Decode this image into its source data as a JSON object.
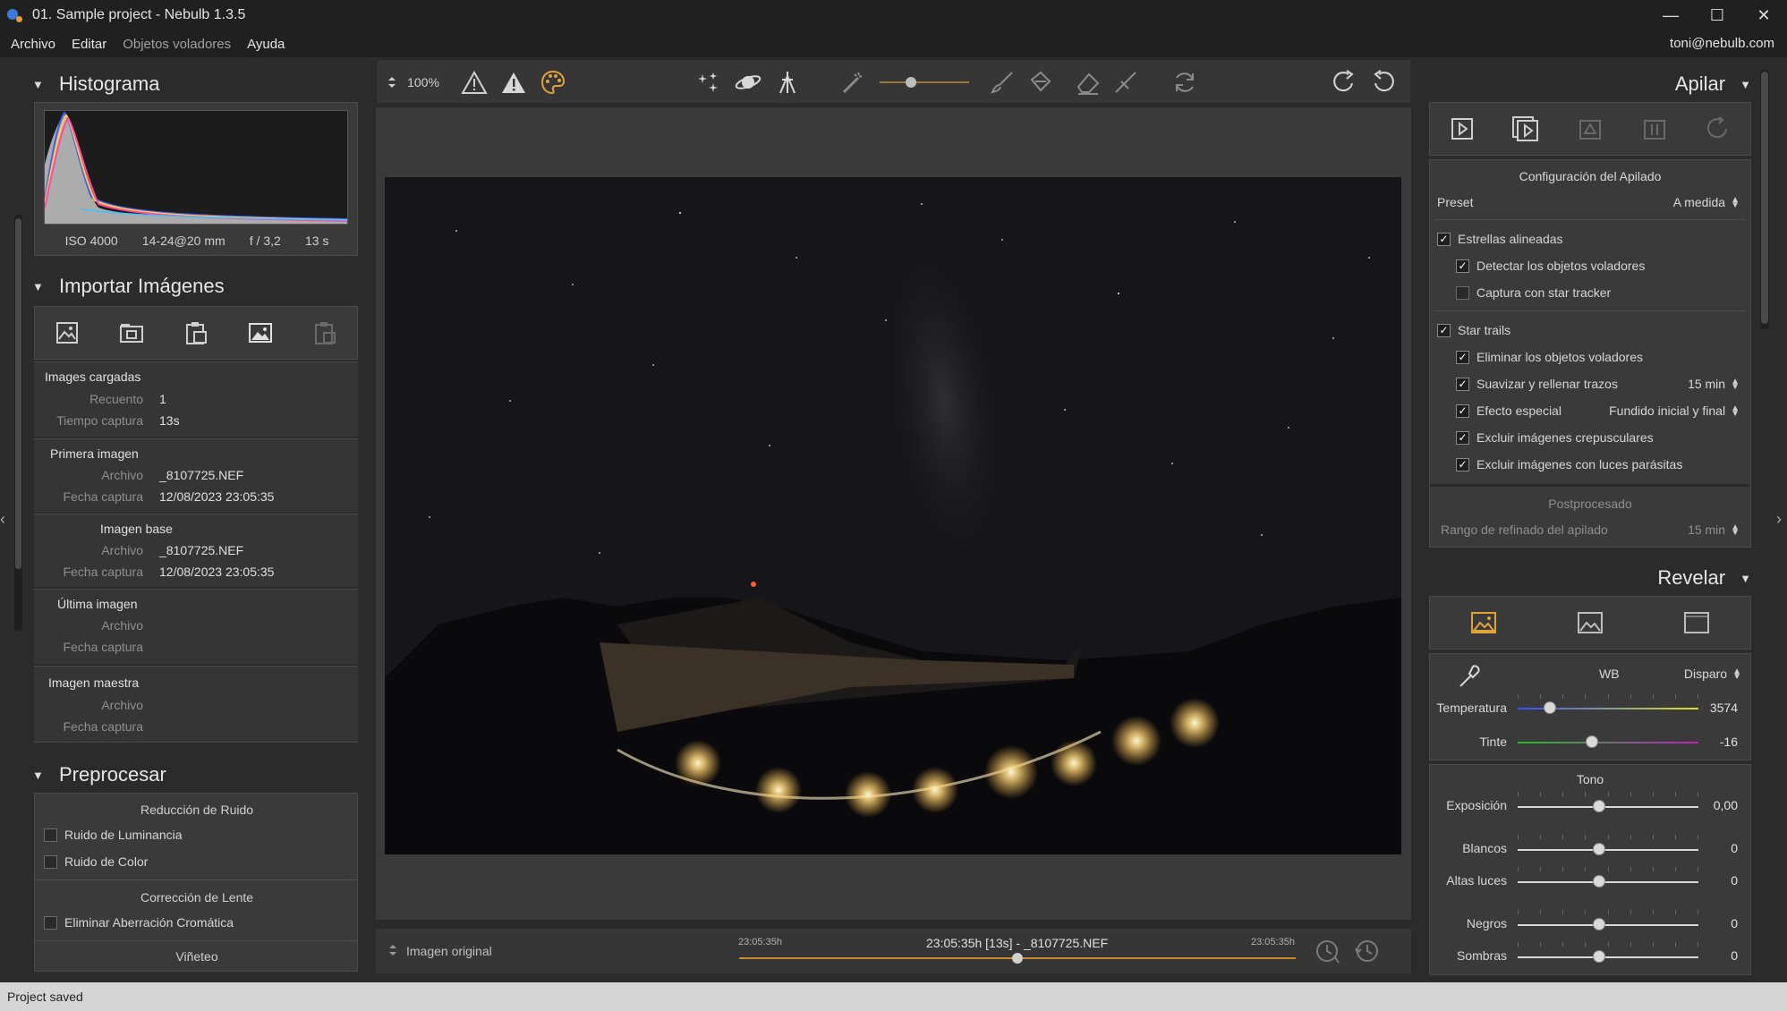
{
  "window": {
    "title": "01. Sample project - Nebulb 1.3.5",
    "minimize": "—",
    "maximize": "☐",
    "close": "✕"
  },
  "menu": {
    "items": [
      "Archivo",
      "Editar",
      "Objetos voladores",
      "Ayuda"
    ],
    "user": "toni@nebulb.com"
  },
  "histogram": {
    "title": "Histograma",
    "iso": "ISO 4000",
    "lens": "14-24@20 mm",
    "aperture": "f / 3,2",
    "exposure": "13 s"
  },
  "import": {
    "title": "Importar Imágenes",
    "loaded": {
      "title": "Images cargadas",
      "count_label": "Recuento",
      "count_value": "1",
      "time_label": "Tiempo captura",
      "time_value": "13s"
    },
    "first": {
      "title": "Primera imagen",
      "file_label": "Archivo",
      "file_value": "_8107725.NEF",
      "date_label": "Fecha captura",
      "date_value": "12/08/2023 23:05:35"
    },
    "base": {
      "title": "Imagen base",
      "file_label": "Archivo",
      "file_value": "_8107725.NEF",
      "date_label": "Fecha captura",
      "date_value": "12/08/2023 23:05:35"
    },
    "last": {
      "title": "Última imagen",
      "file_label": "Archivo",
      "date_label": "Fecha captura"
    },
    "master": {
      "title": "Imagen maestra",
      "file_label": "Archivo",
      "date_label": "Fecha captura"
    }
  },
  "preprocess": {
    "title": "Preprocesar",
    "noise_title": "Reducción de Ruido",
    "luminance": "Ruido de Luminancia",
    "color": "Ruido de Color",
    "lens_title": "Corrección de Lente",
    "chromatic": "Eliminar Aberración Cromática",
    "vignette": "Viñeteo"
  },
  "toolbar": {
    "zoom": "100%",
    "slider_fraction": 0.35
  },
  "timeline": {
    "mode": "Imagen original",
    "start": "23:05:35h",
    "center": "23:05:35h [13s] - _8107725.NEF",
    "end": "23:05:35h",
    "position_fraction": 0.5
  },
  "stack": {
    "title": "Apilar",
    "config_title": "Configuración del Apilado",
    "preset_label": "Preset",
    "preset_value": "A medida",
    "aligned": "Estrellas alineadas",
    "detect_flying": "Detectar los objetos voladores",
    "star_tracker": "Captura con star tracker",
    "star_trails": "Star trails",
    "remove_flying": "Eliminar los objetos voladores",
    "smooth": "Suavizar y rellenar trazos",
    "smooth_value": "15 min",
    "effect": "Efecto especial",
    "effect_value": "Fundido inicial y final",
    "exclude_twilight": "Excluir imágenes crepusculares",
    "exclude_lights": "Excluir imágenes con luces parásitas",
    "post_title": "Postprocesado",
    "refine_label": "Rango de refinado del apilado",
    "refine_value": "15 min"
  },
  "develop": {
    "title": "Revelar",
    "wb_label": "WB",
    "wb_value": "Disparo",
    "temp_label": "Temperatura",
    "temp_value": "3574",
    "temp_fraction": 0.18,
    "tint_label": "Tinte",
    "tint_value": "-16",
    "tint_fraction": 0.41,
    "tone_title": "Tono",
    "exposure_label": "Exposición",
    "exposure_value": "0,00",
    "whites_label": "Blancos",
    "whites_value": "0",
    "highlights_label": "Altas luces",
    "highlights_value": "0",
    "blacks_label": "Negros",
    "blacks_value": "0",
    "shadows_label": "Sombras",
    "shadows_value": "0"
  },
  "status": {
    "text": "Project saved"
  },
  "colors": {
    "accent_orange": "#e0a33a",
    "panel_bg": "#2b2b2b",
    "box_bg": "#3a3a3a"
  }
}
